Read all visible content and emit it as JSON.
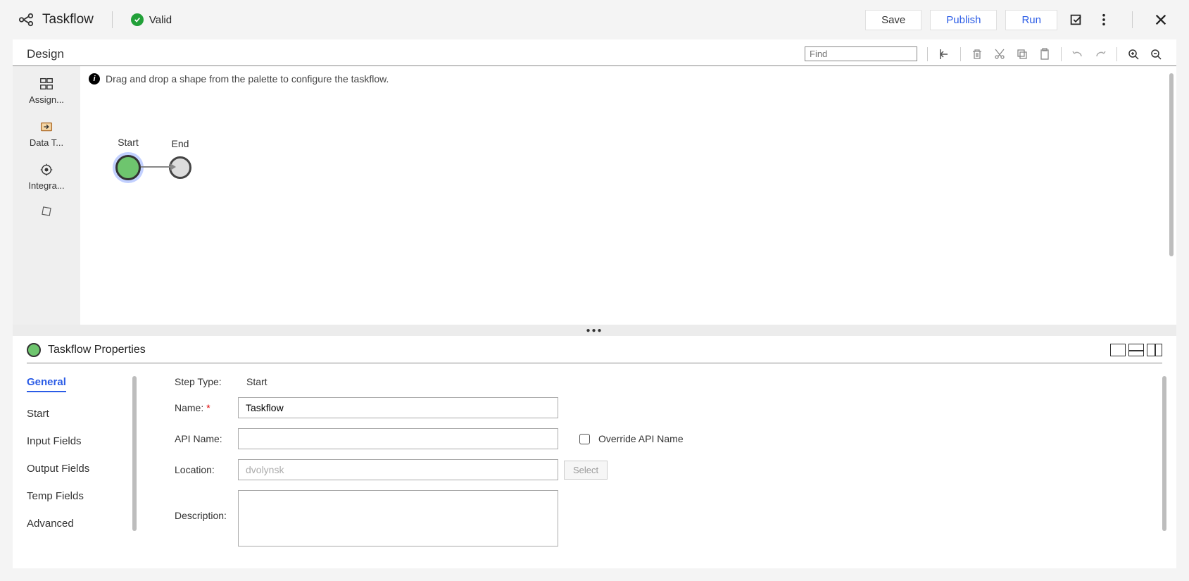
{
  "header": {
    "title": "Taskflow",
    "status": "Valid",
    "save": "Save",
    "publish": "Publish",
    "run": "Run"
  },
  "design": {
    "title": "Design",
    "find_placeholder": "Find",
    "hint": "Drag and drop a shape from the palette to configure the taskflow.",
    "palette": [
      "Assign...",
      "Data T...",
      "Integra..."
    ],
    "nodes": {
      "start": "Start",
      "end": "End"
    }
  },
  "props": {
    "title": "Taskflow Properties",
    "nav": [
      "General",
      "Start",
      "Input Fields",
      "Output Fields",
      "Temp Fields",
      "Advanced"
    ],
    "form": {
      "step_type_label": "Step Type:",
      "step_type_value": "Start",
      "name_label": "Name:",
      "name_value": "Taskflow",
      "api_name_label": "API Name:",
      "api_name_value": "",
      "override_label": "Override API Name",
      "location_label": "Location:",
      "location_placeholder": "dvolynsk",
      "select_label": "Select",
      "description_label": "Description:",
      "description_value": ""
    }
  }
}
